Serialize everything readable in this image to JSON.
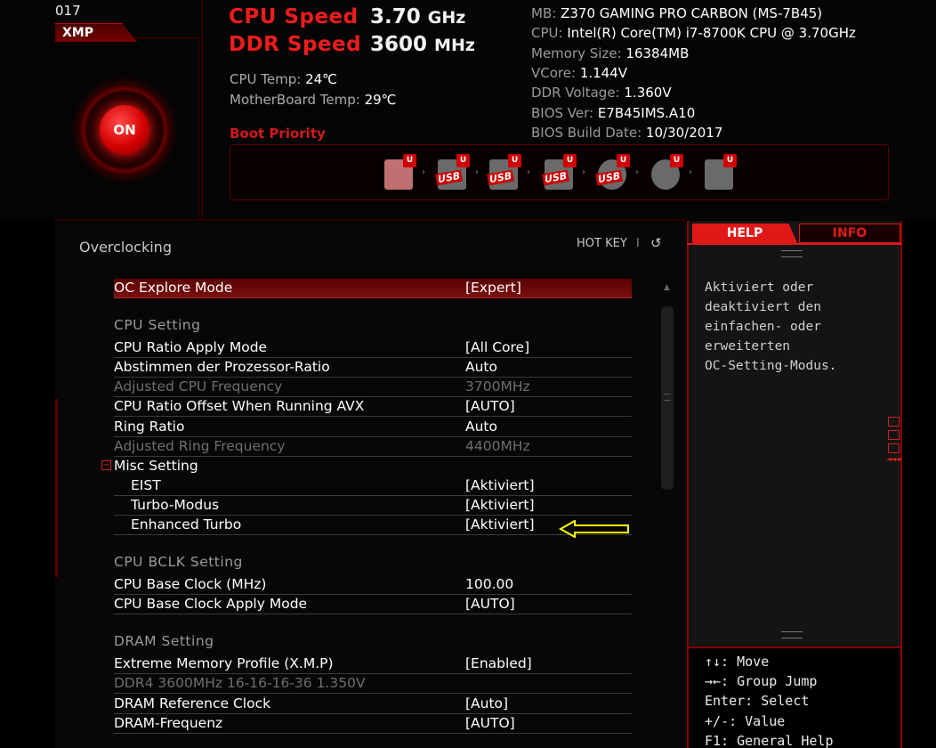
{
  "header": {
    "year_fragment": "017",
    "xmp_label": "XMP",
    "on_label": "ON",
    "cpu_speed_label": "CPU Speed",
    "cpu_speed_value": "3.70",
    "cpu_speed_unit": "GHz",
    "ddr_speed_label": "DDR Speed",
    "ddr_speed_value": "3600",
    "ddr_speed_unit": "MHz",
    "cpu_temp_label": "CPU Temp:",
    "cpu_temp_value": "24℃",
    "mb_temp_label": "MotherBoard Temp:",
    "mb_temp_value": "29℃",
    "boot_priority_label": "Boot Priority",
    "boot_devices": [
      {
        "icon": "hdd-icon",
        "label": "",
        "badge": "U"
      },
      {
        "icon": "usb-hdd-icon",
        "label": "USB",
        "badge": "U"
      },
      {
        "icon": "usb-stick-icon",
        "label": "USB",
        "badge": "U"
      },
      {
        "icon": "usb-floppy-icon",
        "label": "USB",
        "badge": "U"
      },
      {
        "icon": "usb-cd-icon",
        "label": "USB",
        "badge": "U"
      },
      {
        "icon": "cd-icon",
        "label": "",
        "badge": "U"
      },
      {
        "icon": "network-icon",
        "label": "",
        "badge": "U"
      }
    ],
    "sysinfo": [
      {
        "label": "MB:",
        "value": "Z370 GAMING PRO CARBON (MS-7B45)"
      },
      {
        "label": "CPU:",
        "value": "Intel(R) Core(TM) i7-8700K CPU @ 3.70GHz"
      },
      {
        "label": "Memory Size:",
        "value": "16384MB"
      },
      {
        "label": "VCore:",
        "value": "1.144V"
      },
      {
        "label": "DDR Voltage:",
        "value": "1.360V"
      },
      {
        "label": "BIOS Ver:",
        "value": "E7B45IMS.A10"
      },
      {
        "label": "BIOS Build Date:",
        "value": "10/30/2017"
      }
    ]
  },
  "main": {
    "title": "Overclocking",
    "hotkey_label": "HOT KEY",
    "hotkey_sep": "I",
    "back_icon": "↺",
    "rows": [
      {
        "label": "OC Explore Mode",
        "value": "[Expert]"
      },
      {
        "group": "CPU  Setting"
      },
      {
        "label": "CPU Ratio Apply Mode",
        "value": "[All Core]"
      },
      {
        "label": "Abstimmen der Prozessor-Ratio",
        "value": "Auto"
      },
      {
        "label": "Adjusted CPU Frequency",
        "value": "3700MHz"
      },
      {
        "label": "CPU Ratio Offset When Running AVX",
        "value": "[AUTO]"
      },
      {
        "label": "Ring Ratio",
        "value": "Auto"
      },
      {
        "label": "Adjusted Ring Frequency",
        "value": "4400MHz"
      },
      {
        "label": "Misc Setting",
        "toggle": "⊟"
      },
      {
        "label": "EIST",
        "value": "[Aktiviert]"
      },
      {
        "label": "Turbo-Modus",
        "value": "[Aktiviert]"
      },
      {
        "label": "Enhanced Turbo",
        "value": "[Aktiviert]"
      },
      {
        "group": "CPU  BCLK  Setting"
      },
      {
        "label": "CPU Base Clock (MHz)",
        "value": "100.00"
      },
      {
        "label": "CPU Base Clock Apply Mode",
        "value": "[AUTO]"
      },
      {
        "group": "DRAM  Setting"
      },
      {
        "label": "Extreme Memory Profile (X.M.P)",
        "value": "[Enabled]"
      },
      {
        "label": "DDR4 3600MHz 16-16-16-36 1.350V",
        "value": ""
      },
      {
        "label": "DRAM Reference Clock",
        "value": "[Auto]"
      },
      {
        "label": "DRAM-Frequenz",
        "value": "[AUTO]"
      }
    ]
  },
  "help": {
    "tab_help": "HELP",
    "tab_info": "INFO",
    "text_lines": [
      "Aktiviert oder",
      "deaktiviert den",
      "einfachen- oder",
      "erweiterten",
      "OC-Setting-Modus."
    ],
    "keys": [
      "↑↓: Move",
      "→←: Group Jump",
      "Enter: Select",
      "+/-: Value",
      "F1: General Help"
    ]
  },
  "colors": {
    "accent": "#e01818",
    "arrow_annotation": "#ffff00"
  }
}
